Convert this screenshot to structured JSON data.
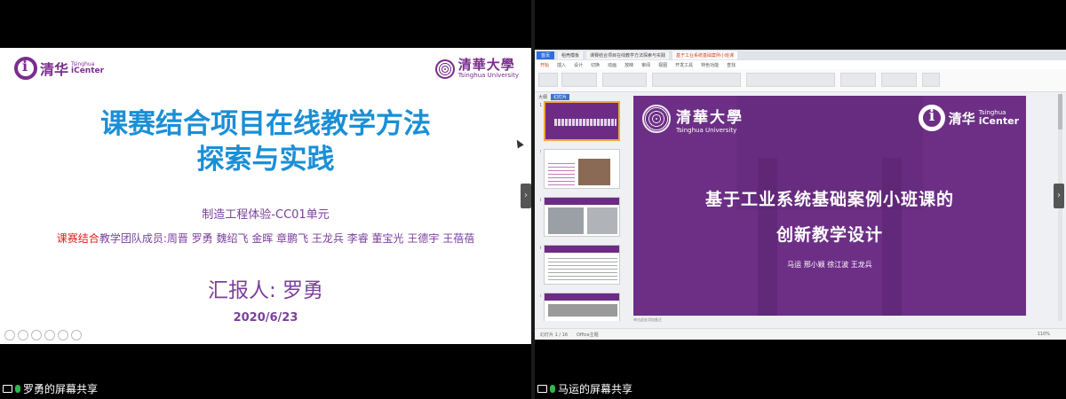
{
  "left_share": {
    "slide": {
      "logo_left_cn": "清华",
      "logo_left_en_top": "Tsinghua",
      "logo_left_en_bottom": "iCenter",
      "logo_right_cn": "清華大學",
      "logo_right_en": "Tsinghua University",
      "title_line1": "课赛结合项目在线教学方法",
      "title_line2": "探索与实践",
      "subtitle": "制造工程体验-CC01单元",
      "team_prefix_red": "课赛结合",
      "team_text": "教学团队成员:周晋  罗勇  魏绍飞  金晖  章鹏飞  王龙兵  李睿  董宝光  王德宇  王蓓蓓",
      "reporter": "汇报人: 罗勇",
      "date": "2020/6/23"
    },
    "share_label": "罗勇的屏幕共享"
  },
  "right_share": {
    "app": {
      "tabs": [
        "首页",
        "稻壳模板",
        "课赛结合项目在线教学方法探索与实践",
        "基于工业系统基础案例小班课"
      ],
      "menus": [
        "开始",
        "插入",
        "设计",
        "切换",
        "动画",
        "放映",
        "审阅",
        "视图",
        "开发工具",
        "特色功能",
        "查找"
      ],
      "view_tabs": [
        "大纲",
        "幻灯片"
      ],
      "notes_placeholder": "单击此处添加备注",
      "status_left": "幻灯片 1 / 16",
      "status_theme": "Office主题",
      "zoom": "110%"
    },
    "slide": {
      "logo_left_cn": "清華大學",
      "logo_left_en": "Tsinghua University",
      "logo_right_cn": "清华",
      "logo_right_en_top": "Tsinghua",
      "logo_right_en_bottom": "iCenter",
      "title_line1": "基于工业系统基础案例小班课的",
      "title_line2": "创新教学设计",
      "authors": "马运 邢小颖 徐江波 王龙兵"
    },
    "thumb_numbers": [
      "1",
      "2",
      "3",
      "4",
      "5"
    ],
    "share_label": "马运的屏幕共享"
  },
  "icons": {
    "nav_arrow": "chevron-right-icon",
    "screen_share": "screen-icon",
    "mic": "mic-icon"
  },
  "colors": {
    "purple": "#7b2d8e",
    "title_blue": "#1a8fd6",
    "red": "#e0221c"
  }
}
